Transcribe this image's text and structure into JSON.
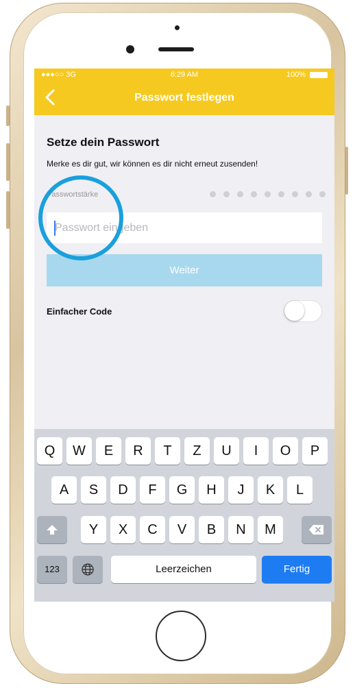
{
  "status_bar": {
    "carrier": "●●●○○ 3G",
    "time": "6:29 AM",
    "battery": "100%"
  },
  "nav": {
    "title": "Passwort festlegen"
  },
  "content": {
    "heading": "Setze dein Passwort",
    "description": "Merke es dir gut, wir können es dir nicht erneut zusenden!",
    "strength_label": "Passwortstärke",
    "password_placeholder": "Passwort eingeben",
    "continue_label": "Weiter",
    "simple_code_label": "Einfacher Code"
  },
  "keyboard": {
    "row1": [
      "Q",
      "W",
      "E",
      "R",
      "T",
      "Z",
      "U",
      "I",
      "O",
      "P"
    ],
    "row2": [
      "A",
      "S",
      "D",
      "F",
      "G",
      "H",
      "J",
      "K",
      "L"
    ],
    "row3": [
      "Y",
      "X",
      "C",
      "V",
      "B",
      "N",
      "M"
    ],
    "numbers_label": "123",
    "space_label": "Leerzeichen",
    "done_label": "Fertig"
  },
  "colors": {
    "accent": "#f6c920",
    "highlight": "#1aa0dc",
    "button": "#a8d8ee",
    "done": "#1e7cf2"
  }
}
